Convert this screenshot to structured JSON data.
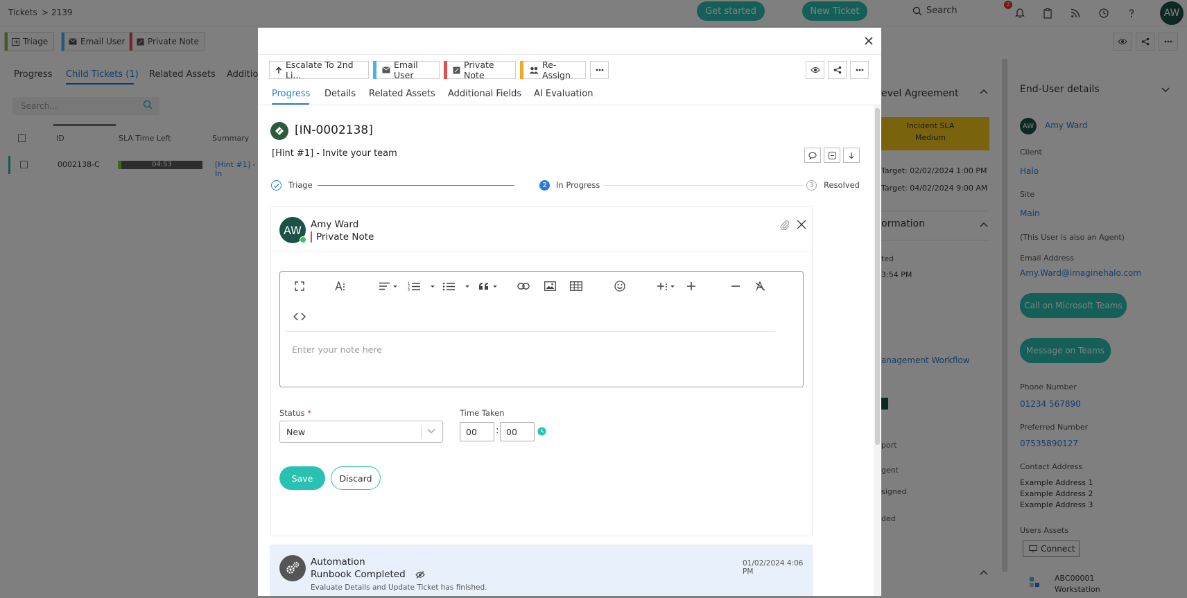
{
  "background": {
    "breadcrumb": [
      "Tickets",
      ">",
      "2139"
    ],
    "get_started_label": "Get started",
    "new_ticket_label": "New Ticket",
    "search_label": "Search",
    "notification_count": "2",
    "user_initials": "AW",
    "actions": [
      "Triage",
      "Email User",
      "Private Note"
    ],
    "tabs": [
      "Progress",
      "Child Tickets (1)",
      "Related Assets",
      "Additio"
    ],
    "search_placeholder": "Search...",
    "table_headers": {
      "id": "ID",
      "sla": "SLA Time Left",
      "summary": "Summary"
    },
    "row": {
      "id": "0002138-C",
      "sla": "04:53",
      "summary": "[Hint #1] - In"
    },
    "sla_panel": {
      "header": "evel Agreement",
      "sla_line1": "Incident SLA",
      "sla_line2": "Medium",
      "target1": "Target: 02/02/2024 1:00 PM",
      "target2": "Target: 04/02/2024 9:00 AM"
    },
    "info_panel": {
      "header": "ormation",
      "items": [
        "ted",
        "3:54 PM",
        "anagement Workflow",
        "port",
        "gent",
        "signed",
        "ded"
      ]
    },
    "end_user": {
      "header": "End-User details",
      "initials": "AW",
      "name": "Amy Ward",
      "client_label": "Client",
      "client": "Halo",
      "site_label": "Site",
      "site": "Main",
      "agent_note": "(This User is also an Agent)",
      "email_label": "Email Address",
      "email": "Amy.Ward@imaginehalo.com",
      "call_teams": "Call on Microsoft Teams",
      "message_teams": "Message on Teams",
      "phone_label": "Phone Number",
      "phone": "01234 567890",
      "preferred_label": "Preferred Number",
      "preferred": "07535890127",
      "contact_label": "Contact Address",
      "address": [
        "Example Address 1",
        "Example Address 2",
        "Example Address 3"
      ],
      "assets_label": "Users Assets",
      "connect_label": "Connect",
      "asset_id": "ABC00001",
      "asset_type": "Workstation"
    }
  },
  "modal": {
    "actions": [
      {
        "label": "Escalate To 2nd Li...",
        "icon": "arrow-up-icon",
        "color": ""
      },
      {
        "label": "Email User",
        "icon": "envelope-icon",
        "color": "#4ab3e8"
      },
      {
        "label": "Private Note",
        "icon": "note-icon",
        "color": "#e05050"
      },
      {
        "label": "Re-Assign",
        "icon": "users-icon",
        "color": "#f5a623"
      }
    ],
    "tabs": [
      "Progress",
      "Details",
      "Related Assets",
      "Additional Fields",
      "AI Evaluation"
    ],
    "ticket_id": "[IN-0002138]",
    "summary": "[Hint #1] - Invite your team",
    "steps": [
      {
        "number": "",
        "label": "Triage"
      },
      {
        "number": "2",
        "label": "In Progress"
      },
      {
        "number": "3",
        "label": "Resolved"
      }
    ],
    "note": {
      "avatar_initials": "AW",
      "author": "Amy Ward",
      "type": "Private Note",
      "placeholder": "Enter your note here",
      "status_label": "Status",
      "status_required": "*",
      "status_value": "New",
      "time_label": "Time Taken",
      "time_hours": "00",
      "time_minutes": "00",
      "time_separator": ":",
      "save_label": "Save",
      "discard_label": "Discard"
    },
    "automation": {
      "author": "Automation",
      "time": "01/02/2024 4:06 PM",
      "title": "Runbook Completed",
      "description": "Evaluate Details and Update Ticket has finished."
    }
  }
}
